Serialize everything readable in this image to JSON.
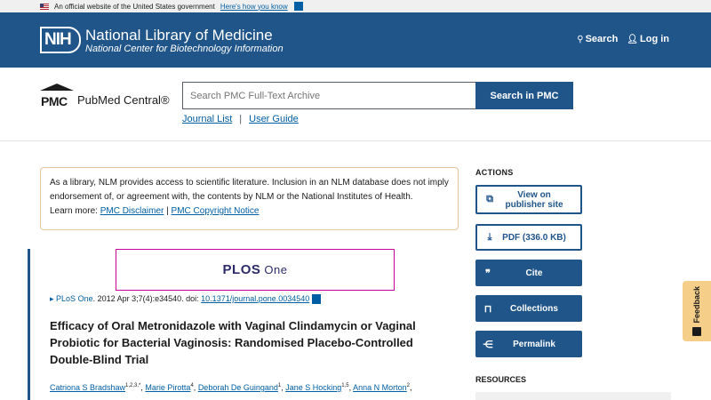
{
  "gov_banner": {
    "text": "An official website of the United States government",
    "link": "Here's how you know"
  },
  "nih": {
    "logo_text": "NIH",
    "title": "National Library of Medicine",
    "subtitle": "National Center for Biotechnology Information",
    "search_label": "Search",
    "login_label": "Log in"
  },
  "pmc": {
    "logo_mark": "PMC",
    "logo_name": "PubMed Central®",
    "search_placeholder": "Search PMC Full-Text Archive",
    "search_button": "Search in PMC",
    "link_journal_list": "Journal List",
    "link_separator": "|",
    "link_user_guide": "User Guide"
  },
  "disclaimer": {
    "line1": "As a library, NLM provides access to scientific literature. Inclusion in an NLM database does not imply endorsement of, or agreement with, the contents by NLM or the National Institutes of Health.",
    "learn_more": "Learn more:",
    "link1": "PMC Disclaimer",
    "sep": "|",
    "link2": "PMC Copyright Notice"
  },
  "article": {
    "journal_logo": "PLOS",
    "journal_logo_suffix": "One",
    "citation_arrow": "▸",
    "journal_link": "PLoS One",
    "citation_text": ". 2012 Apr 3;7(4):e34540. doi: ",
    "doi": "10.1371/journal.pone.0034540",
    "title": "Efficacy of Oral Metronidazole with Vaginal Clindamycin or Vaginal Probiotic for Bacterial Vaginosis: Randomised Placebo-Controlled Double-Blind Trial",
    "authors": [
      {
        "name": "Catriona S Bradshaw",
        "sup": "1,2,3,*"
      },
      {
        "name": "Marie Pirotta",
        "sup": "4"
      },
      {
        "name": "Deborah De Guingand",
        "sup": "1"
      },
      {
        "name": "Jane S Hocking",
        "sup": "1,5"
      },
      {
        "name": "Anna N Morton",
        "sup": "2"
      }
    ]
  },
  "actions": {
    "title": "ACTIONS",
    "view_publisher": "View on publisher site",
    "pdf": "PDF (336.0 KB)",
    "cite": "Cite",
    "collections": "Collections",
    "permalink": "Permalink"
  },
  "resources": {
    "title": "RESOURCES"
  },
  "feedback": {
    "label": "Feedback"
  },
  "colors": {
    "primary": "#20558a",
    "link": "#005ea2",
    "plos_border": "#c9009c",
    "feedback_bg": "#f5cf8a"
  }
}
